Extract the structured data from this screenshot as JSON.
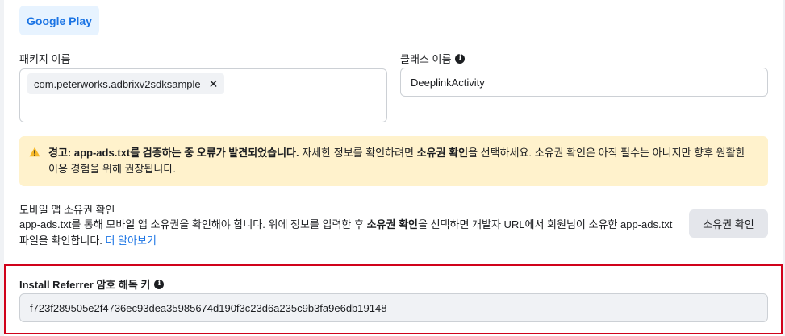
{
  "google_play_button": "Google Play",
  "package": {
    "label": "패키지 이름",
    "chip_value": "com.peterworks.adbrixv2sdksample",
    "chip_remove": "✕"
  },
  "class_name": {
    "label": "클래스 이름",
    "value": "DeeplinkActivity"
  },
  "warning": {
    "bold_text": "경고: app-ads.txt를 검증하는 중 오류가 발견되었습니다.",
    "text_1": " 자세한 정보를 확인하려면 ",
    "bold_mid": "소유권 확인",
    "text_2": "을 선택하세요. 소유권 확인은 아직 필수는 아니지만 향후 원활한 이용 경험을 위해 권장됩니다.",
    "icon_color": "#f7b928"
  },
  "ownership": {
    "title": "모바일 앱 소유권 확인",
    "desc_1": "app-ads.txt를 통해 모바일 앱 소유권을 확인해야 합니다. 위에 정보를 입력한 후 ",
    "desc_bold": "소유권 확인",
    "desc_2": "을 선택하면 개발자 URL에서 회원님이 소유한 app-ads.txt 파일을 확인합니다. ",
    "learn_more": "더 알아보기",
    "verify_button": "소유권 확인"
  },
  "install_referrer": {
    "label": "Install Referrer 암호 해독 키",
    "value": "f723f289505e2f4736ec93dea35985674d190f3c23d6a235c9b3fa9e6db19148",
    "highlight_color": "#d0021b"
  },
  "info_glyph": "i"
}
